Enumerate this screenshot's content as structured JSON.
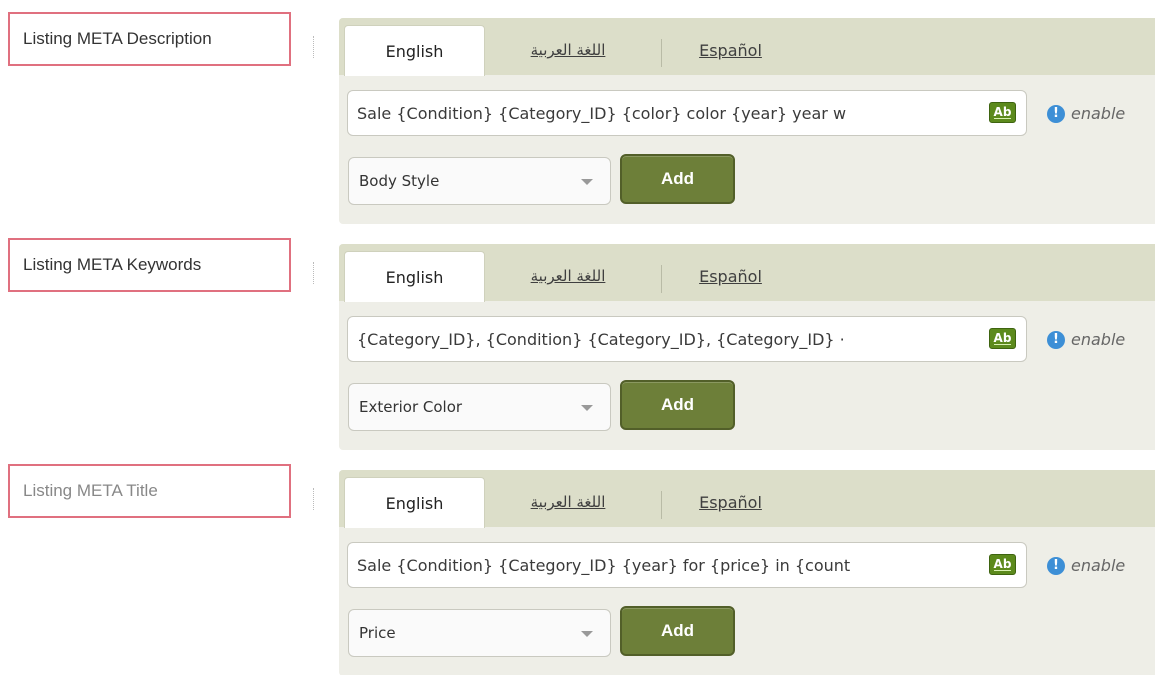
{
  "tabs": {
    "english": "English",
    "arabic": "اللغة العربية",
    "spanish": "Español"
  },
  "sections": [
    {
      "label": "Listing META Description",
      "value": "Sale {Condition} {Category_ID} {color} color {year} year w",
      "hint": "enable",
      "select": "Body Style",
      "add": "Add"
    },
    {
      "label": "Listing META Keywords",
      "value": "{Category_ID}, {Condition} {Category_ID}, {Category_ID} ·",
      "hint": "enable",
      "select": "Exterior Color",
      "add": "Add"
    },
    {
      "label": "Listing META Title",
      "value": "Sale {Condition} {Category_ID} {year} for {price} in {count",
      "hint": "enable",
      "select": "Price",
      "add": "Add"
    }
  ],
  "icons": {
    "ab": "Ab",
    "info": "!"
  },
  "colors": {
    "label_border": "#e0707f",
    "tab_bar": "#dcdec9",
    "panel": "#eeeee7",
    "add_button": "#6d7f39",
    "ab_icon": "#5c8a1c",
    "info_icon": "#3d8fd6"
  }
}
